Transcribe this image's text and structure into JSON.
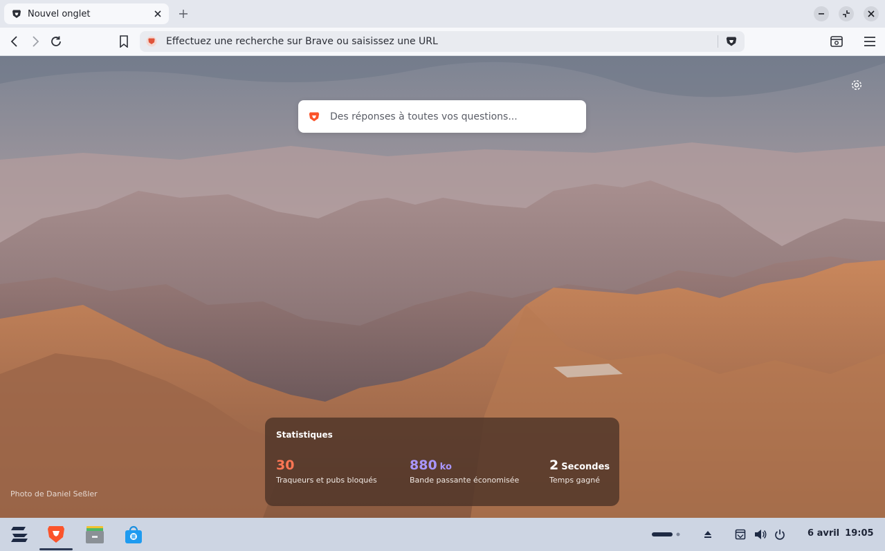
{
  "tab": {
    "title": "Nouvel onglet",
    "favicon": "brave-lion-icon"
  },
  "toolbar": {
    "address_placeholder": "Effectuez une recherche sur Brave ou saisissez une URL"
  },
  "ntp": {
    "search_placeholder": "Des réponses à toutes vos questions...",
    "photo_credit": "Photo de Daniel Seßler",
    "stats": {
      "heading": "Statistiques",
      "trackers": {
        "value": "30",
        "label": "Traqueurs et pubs bloqués",
        "color": "#ff7654"
      },
      "bandwidth": {
        "value": "880",
        "unit": "ko",
        "label": "Bande passante économisée",
        "color": "#a996ff"
      },
      "time": {
        "value": "2",
        "unit": "Secondes",
        "label": "Temps gagné",
        "color": "#ffffff"
      }
    }
  },
  "taskbar": {
    "apps": [
      "zorin-menu-icon",
      "brave-icon",
      "files-icon",
      "software-store-icon"
    ],
    "clock": {
      "date": "6 avril",
      "time": "19:05"
    }
  },
  "colors": {
    "brand": "#fb542b",
    "taskbar_bg": "#cdd5e3"
  }
}
